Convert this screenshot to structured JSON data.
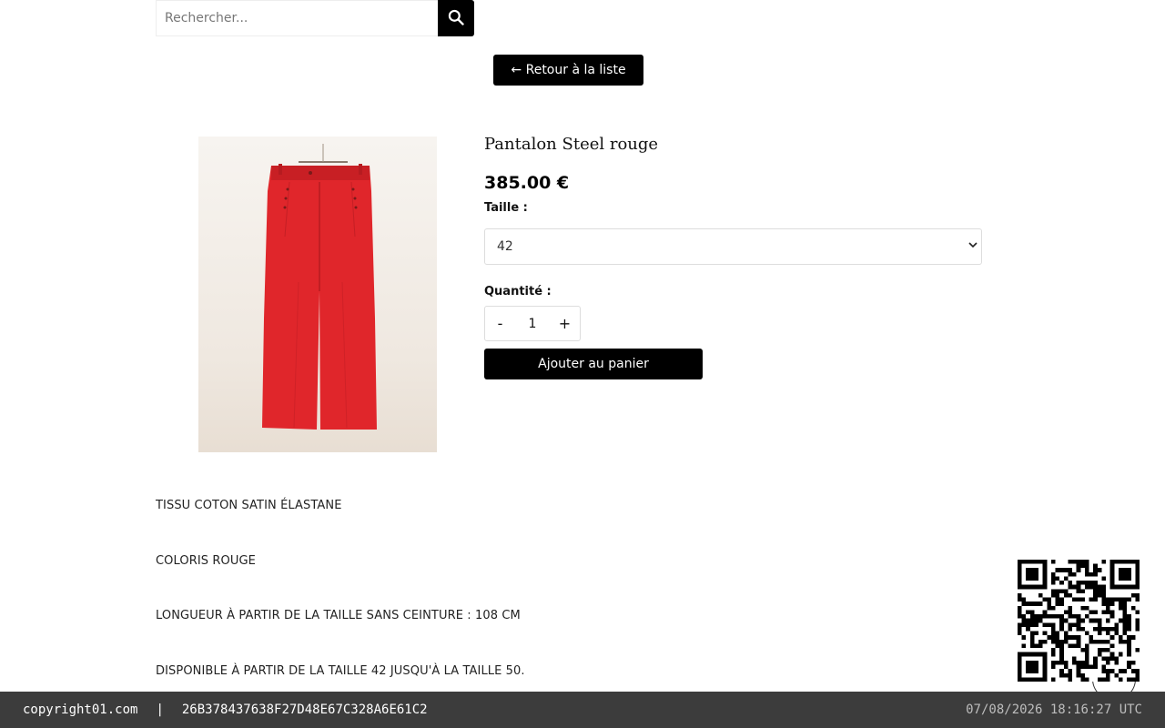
{
  "search": {
    "placeholder": "Rechercher..."
  },
  "back_button": {
    "label": "← Retour à la liste"
  },
  "product": {
    "title": "Pantalon Steel rouge",
    "price": "385.00 €",
    "size_label": "Taille :",
    "selected_size": "42",
    "quantity_label": "Quantité :",
    "quantity_minus": "-",
    "quantity_value": "1",
    "quantity_plus": "+",
    "add_to_cart_label": "Ajouter au panier",
    "color": "#e0262b"
  },
  "description": [
    "TISSU COTON SATIN ÉLASTANE",
    "COLORIS ROUGE",
    "LONGUEUR À PARTIR DE LA TAILLE SANS CEINTURE : 108 CM",
    "DISPONIBLE À PARTIR DE LA TAILLE 42 JUSQU'À LA TAILLE 50."
  ],
  "footer": {
    "site": "copyright01.com",
    "separator": "|",
    "hash": "26B378437638F27D48E67C328A6E61C2",
    "timestamp": "07/08/2026 18:16:27 UTC"
  },
  "colors": {
    "button_bg": "#000000",
    "footer_bg": "#3c3c3c"
  }
}
